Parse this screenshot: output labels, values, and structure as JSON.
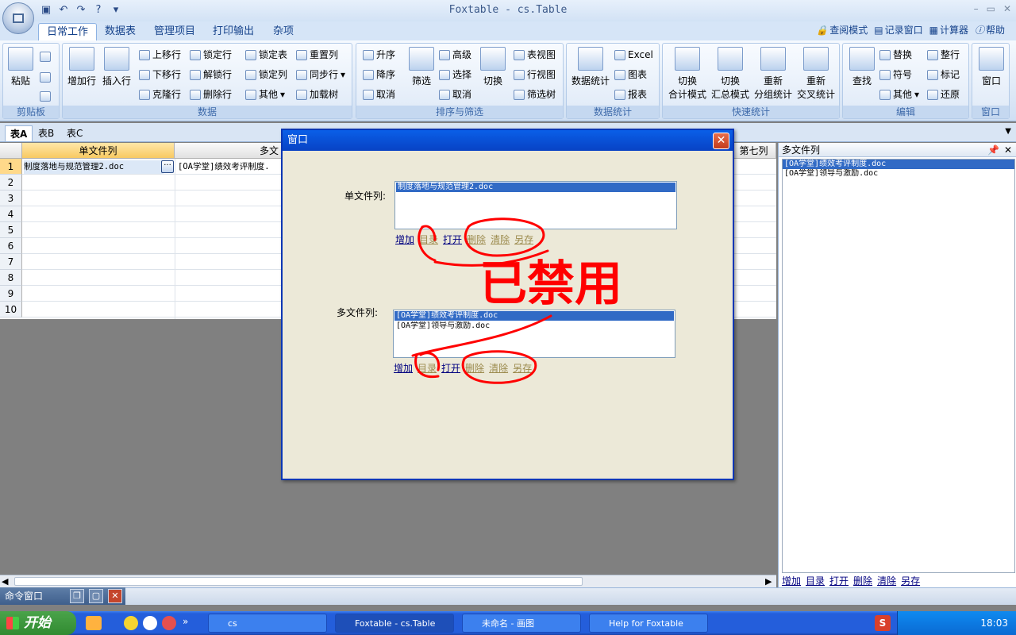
{
  "window": {
    "title": "Foxtable - cs.Table"
  },
  "ribbon_tabs": [
    "日常工作",
    "数据表",
    "管理项目",
    "打印输出",
    "杂项"
  ],
  "tools": [
    "查阅模式",
    "记录窗口",
    "计算器",
    "帮助"
  ],
  "groups": {
    "clipboard": {
      "label": "剪贴板",
      "paste": "粘贴"
    },
    "data": {
      "label": "数据",
      "add_row": "增加行",
      "insert_row": "插入行",
      "move_up": "上移行",
      "move_down": "下移行",
      "clone_row": "克隆行",
      "lock_row": "锁定行",
      "unlock_row": "解锁行",
      "delete_row": "删除行",
      "lock_table": "锁定表",
      "lock_col": "锁定列",
      "other": "其他",
      "reset_col": "重置列",
      "sync_row": "同步行",
      "load_tree": "加载树"
    },
    "sort": {
      "label": "排序与筛选",
      "asc": "升序",
      "desc": "降序",
      "cancel": "取消",
      "filter": "筛选",
      "advanced": "高级",
      "select": "选择",
      "cancel2": "取消",
      "switch": "切换",
      "table_view": "表视图",
      "row_view": "行视图",
      "filter_tree": "筛选树"
    },
    "stats": {
      "label": "数据统计",
      "stats": "数据统计",
      "excel": "Excel",
      "chart": "图表",
      "report": "报表"
    },
    "quick": {
      "label": "快速统计",
      "q1a": "切换",
      "q1b": "合计模式",
      "q2a": "切换",
      "q2b": "汇总模式",
      "q3a": "重新",
      "q3b": "分组统计",
      "q4a": "重新",
      "q4b": "交叉统计"
    },
    "edit": {
      "label": "编辑",
      "find": "查找",
      "replace": "替换",
      "symbol": "符号",
      "other": "其他",
      "whole_row": "整行",
      "mark": "标记",
      "restore": "还原"
    },
    "window": {
      "label": "窗口",
      "window": "窗口"
    }
  },
  "sheet_tabs": [
    "表A",
    "表B",
    "表C"
  ],
  "grid": {
    "col1": "单文件列",
    "col2": "多文",
    "col7": "第七列",
    "rows": [
      "1",
      "2",
      "3",
      "4",
      "5",
      "6",
      "7",
      "8",
      "9",
      "10"
    ],
    "r1c1": "制度落地与规范管理2.doc",
    "r1c2": "[OA学堂]绩效考评制度."
  },
  "right_panel": {
    "title": "多文件列",
    "items": [
      "[OA学堂]绩效考评制度.doc",
      "[OA学堂]领导与激励.doc"
    ],
    "links": [
      "增加",
      "目录",
      "打开",
      "删除",
      "清除",
      "另存"
    ]
  },
  "dialog": {
    "title": "窗口",
    "single_label": "单文件列:",
    "single_items": [
      "制度落地与规范管理2.doc"
    ],
    "multi_label": "多文件列:",
    "multi_items": [
      "[OA学堂]绩效考评制度.doc",
      "[OA学堂]领导与激励.doc"
    ],
    "links": [
      "增加",
      "目录",
      "打开",
      "删除",
      "清除",
      "另存"
    ],
    "annotation": "已禁用"
  },
  "command_window": "命令窗口",
  "taskbar": {
    "start": "开始",
    "tasks": [
      "cs",
      "Foxtable - cs.Table",
      "未命名 - 画图",
      "Help for Foxtable"
    ],
    "clock": "18:03"
  },
  "colors": {
    "selection": "#316ac5",
    "titlebar": "#0a5fe8",
    "annotation": "#ff0000",
    "disabled_link": "#9c8b4e"
  }
}
